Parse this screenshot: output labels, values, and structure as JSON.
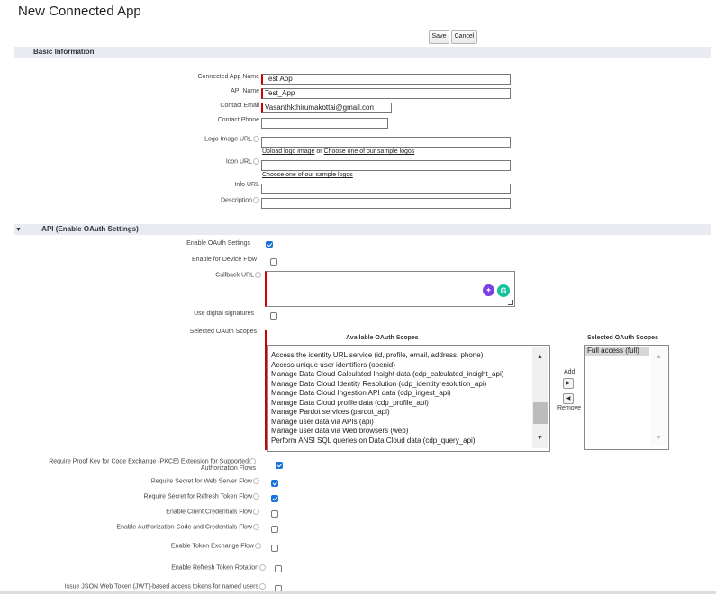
{
  "page": {
    "title": "New Connected App"
  },
  "toolbar": {
    "save_label": "Save",
    "cancel_label": "Cancel"
  },
  "sections": {
    "basic": "Basic Information",
    "api": "API (Enable OAuth Settings)"
  },
  "basic": {
    "app_name_label": "Connected App Name",
    "app_name_value": "Test App",
    "api_name_label": "API Name",
    "api_name_value": "Test_App",
    "email_label": "Contact Email",
    "email_value": "Vasanthkthirumakottai@gmail.con",
    "phone_label": "Contact Phone",
    "phone_value": "",
    "logo_label": "Logo Image URL",
    "logo_value": "",
    "upload_logo_link": "Upload logo image",
    "or_text": "or",
    "sample_logos_link": "Choose one of our sample logos",
    "icon_label": "Icon URL",
    "icon_value": "",
    "icon_sample_link": "Choose one of our sample logos",
    "info_label": "Info URL",
    "info_value": "",
    "description_label": "Description",
    "description_value": ""
  },
  "oauth": {
    "enable_label": "Enable OAuth Settings",
    "enable_checked": true,
    "device_flow_label": "Enable for Device Flow",
    "device_flow_checked": false,
    "callback_label": "Callback URL",
    "callback_value": "",
    "digital_sig_label": "Use digital signatures",
    "digital_sig_checked": false,
    "scopes_label": "Selected OAuth Scopes",
    "available_header": "Available OAuth Scopes",
    "selected_header": "Selected OAuth Scopes",
    "available_scopes": [
      "Access the identity URL service (id, profile, email, address, phone)",
      "Access unique user identifiers (openid)",
      "Manage Data Cloud Calculated Insight data (cdp_calculated_insight_api)",
      "Manage Data Cloud Identity Resolution (cdp_identityresolution_api)",
      "Manage Data Cloud Ingestion API data (cdp_ingest_api)",
      "Manage Data Cloud profile data (cdp_profile_api)",
      "Manage Pardot services (pardot_api)",
      "Manage user data via APIs (api)",
      "Manage user data via Web browsers (web)",
      "Perform ANSI SQL queries on Data Cloud data (cdp_query_api)"
    ],
    "selected_scopes": [
      "Full access (full)"
    ],
    "add_label": "Add",
    "remove_label": "Remove",
    "pkce_label_line1": "Require Proof Key for Code Exchange (PKCE) Extension for Supported",
    "pkce_label_line2": "Authorization Flows",
    "pkce_checked": true,
    "secret_web_label": "Require Secret for Web Server Flow",
    "secret_web_checked": true,
    "secret_refresh_label": "Require Secret for Refresh Token Flow",
    "secret_refresh_checked": true,
    "client_cred_label": "Enable Client Credentials Flow",
    "client_cred_checked": false,
    "auth_code_label": "Enable Authorization Code and Credentials Flow",
    "auth_code_checked": false,
    "token_exchange_label": "Enable Token Exchange Flow",
    "token_exchange_checked": false,
    "refresh_rotation_label": "Enable Refresh Token Rotation",
    "refresh_rotation_checked": false,
    "jwt_label": "Issue JSON Web Token (JWT)-based access tokens for named users",
    "jwt_checked": false
  }
}
